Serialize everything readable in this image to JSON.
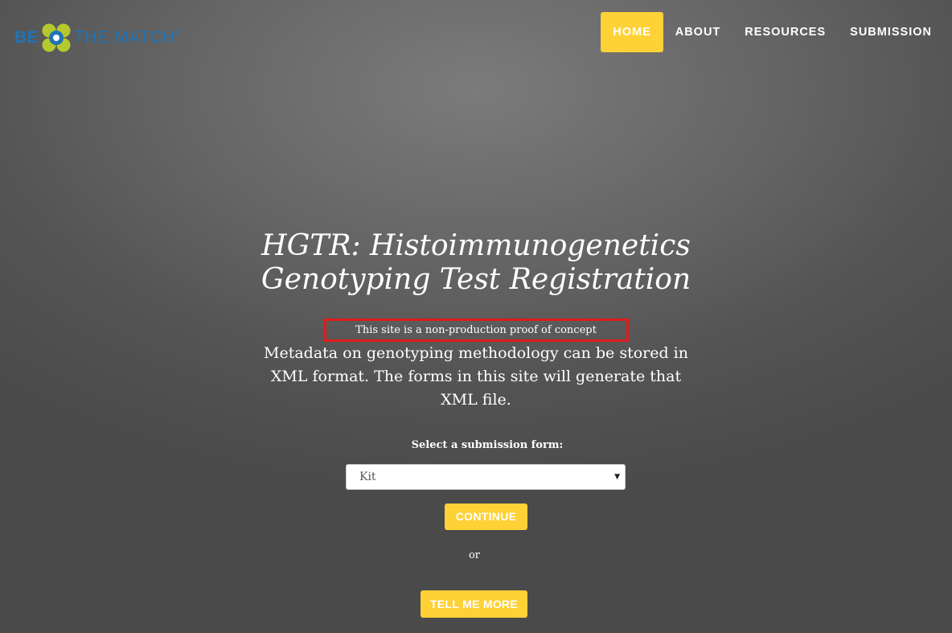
{
  "brand": {
    "be": "BE",
    "the_match": "THE MATCH",
    "trademark": "®",
    "colors": {
      "blue": "#1f73b6",
      "green": "#b5c92f"
    }
  },
  "nav": {
    "items": [
      {
        "label": "HOME",
        "active": true
      },
      {
        "label": "ABOUT",
        "active": false
      },
      {
        "label": "RESOURCES",
        "active": false
      },
      {
        "label": "SUBMISSION",
        "active": false
      }
    ],
    "active_color": "#fed136"
  },
  "hero": {
    "title": "HGTR: Histoimmunogenetics Genotyping Test Registration",
    "notice": "This site is a non-production proof of concept",
    "description": "Metadata on genotyping methodology can be stored in XML format. The forms in this site will generate that XML file.",
    "select_label": "Select a submission form:",
    "select_value": "Kit",
    "continue_label": "CONTINUE",
    "or_text": "or",
    "tell_me_more_label": "TELL ME MORE"
  },
  "colors": {
    "accent": "#fed136",
    "notice_border": "#e01b1b"
  }
}
